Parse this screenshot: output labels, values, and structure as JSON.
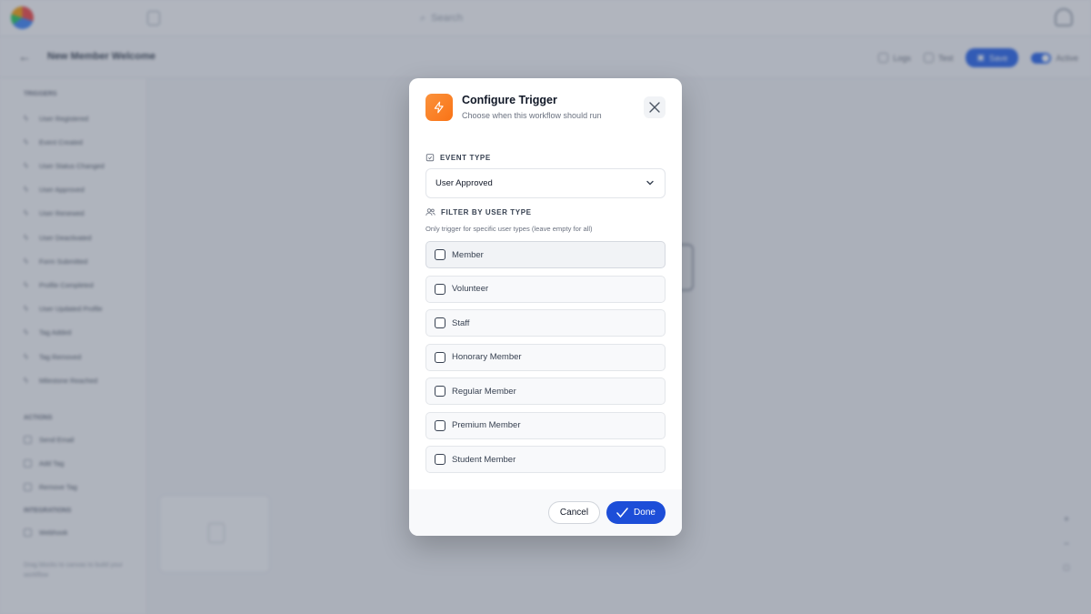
{
  "app": {
    "search_placeholder": "Search",
    "workflow_title": "New Member Welcome",
    "actions": {
      "logs": "Logs",
      "test": "Test",
      "save": "Save",
      "status": "Active"
    },
    "sidebar": {
      "section_triggers": "TRIGGERS",
      "triggers": [
        "User Registered",
        "Event Created",
        "User Status Changed",
        "User Approved",
        "User Renewed",
        "User Deactivated",
        "Form Submitted",
        "Profile Completed",
        "User Updated Profile",
        "Tag Added",
        "Tag Removed",
        "Milestone Reached"
      ],
      "section_actions": "ACTIONS",
      "actions": [
        "Send Email",
        "Add Tag",
        "Remove Tag"
      ],
      "section_integrations": "INTEGRATIONS",
      "integrations": [
        "Webhook"
      ],
      "footer": "Drag blocks to canvas to build your workflow"
    }
  },
  "modal": {
    "title": "Configure Trigger",
    "subtitle": "Choose when this workflow should run",
    "event_type_label": "EVENT TYPE",
    "event_type_value": "User Approved",
    "filter_label": "FILTER BY USER TYPE",
    "filter_hint": "Only trigger for specific user types (leave empty for all)",
    "user_types": [
      {
        "label": "Member",
        "checked": false
      },
      {
        "label": "Volunteer",
        "checked": false
      },
      {
        "label": "Staff",
        "checked": false
      },
      {
        "label": "Honorary Member",
        "checked": false
      },
      {
        "label": "Regular Member",
        "checked": false
      },
      {
        "label": "Premium Member",
        "checked": false
      },
      {
        "label": "Student Member",
        "checked": false
      }
    ],
    "cancel_label": "Cancel",
    "done_label": "Done"
  },
  "colors": {
    "accent": "#1d4ed8",
    "trigger_icon": "#f97316"
  }
}
